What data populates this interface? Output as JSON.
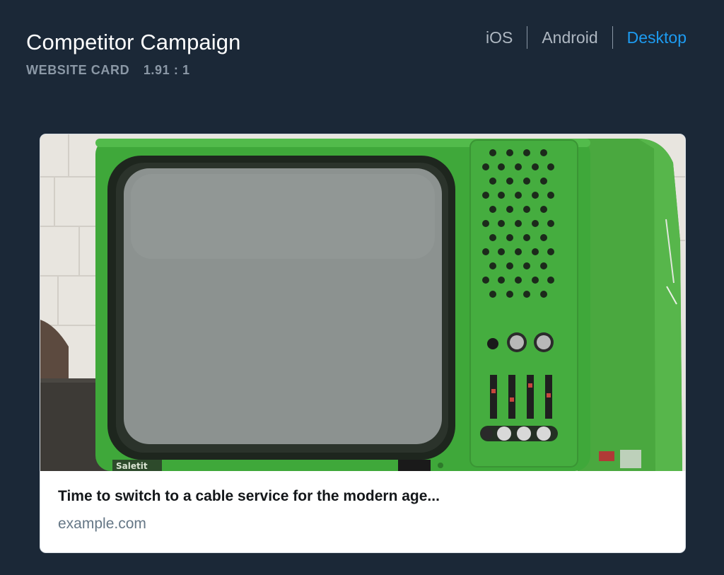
{
  "header": {
    "title": "Competitor Campaign",
    "card_type": "WEBSITE CARD",
    "aspect_ratio": "1.91 : 1"
  },
  "platform_tabs": [
    {
      "label": "iOS",
      "active": false
    },
    {
      "label": "Android",
      "active": false
    },
    {
      "label": "Desktop",
      "active": true
    }
  ],
  "card": {
    "image_subject": "vintage-green-television",
    "tv_brand": "Saletit",
    "headline": "Time to switch to a cable service for the modern age...",
    "domain": "example.com"
  },
  "colors": {
    "background": "#1b2837",
    "accent": "#1d9bf0",
    "tab_inactive": "#aeb7c1",
    "subtitle": "#8b98a6",
    "card_background": "#ffffff",
    "domain_text": "#657786"
  }
}
